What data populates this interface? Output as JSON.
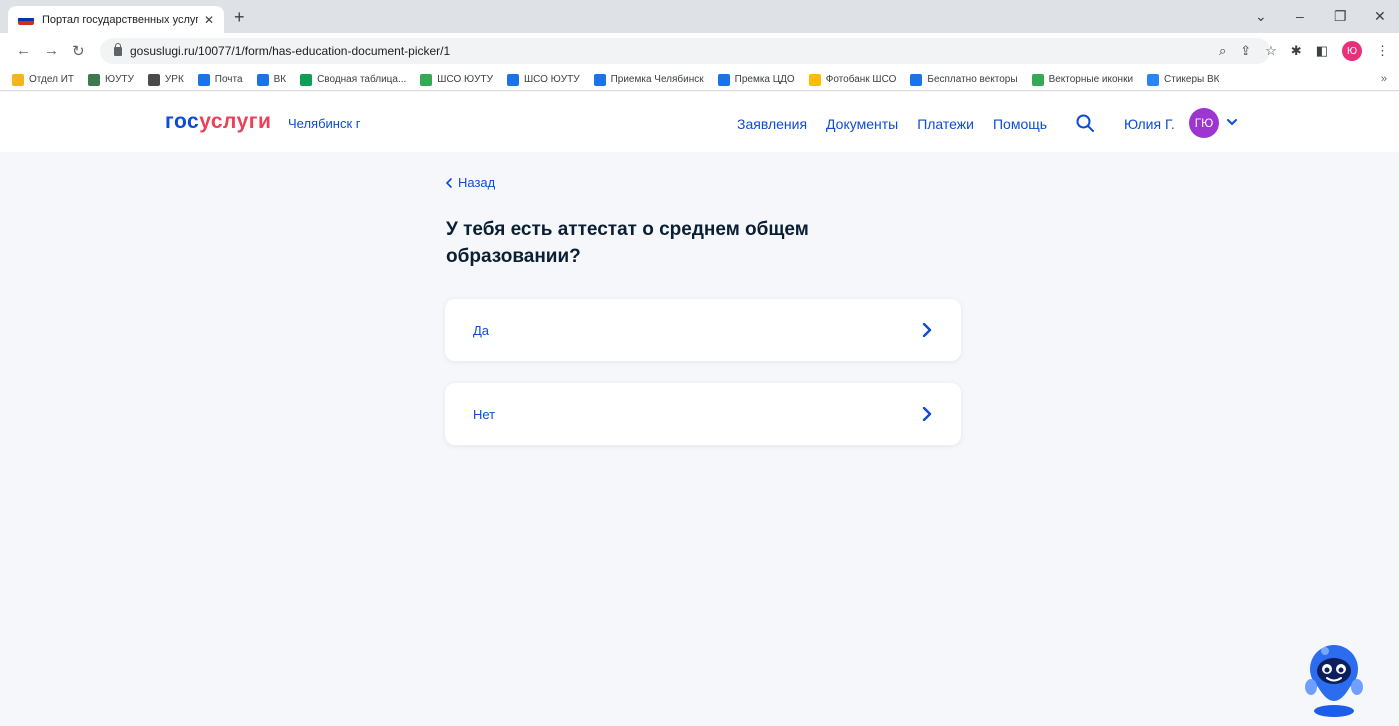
{
  "browser": {
    "tab_title": "Портал государственных услуг",
    "url": "gosuslugi.ru/10077/1/form/has-education-document-picker/1",
    "profile_initial": "Ю",
    "bookmarks": [
      {
        "label": "Отдел ИТ",
        "color": "#f2b51c"
      },
      {
        "label": "ЮУТУ",
        "color": "#3d7a4e"
      },
      {
        "label": "УРК",
        "color": "#4a4a4a"
      },
      {
        "label": "Почта",
        "color": "#1a73e8"
      },
      {
        "label": "ВК",
        "color": "#1a73e8"
      },
      {
        "label": "Сводная таблица...",
        "color": "#0f9d58"
      },
      {
        "label": "ШСО ЮУТУ",
        "color": "#34a853"
      },
      {
        "label": "ШСО ЮУТУ",
        "color": "#1a73e8"
      },
      {
        "label": "Приемка Челябинск",
        "color": "#1a73e8"
      },
      {
        "label": "Премка ЦДО",
        "color": "#1a73e8"
      },
      {
        "label": "Фотобанк ШСО",
        "color": "#fbbc04"
      },
      {
        "label": "Бесплатно векторы",
        "color": "#1a73e8"
      },
      {
        "label": "Векторные иконки",
        "color": "#34a853"
      },
      {
        "label": "Стикеры ВК",
        "color": "#2787f5"
      }
    ]
  },
  "header": {
    "logo_part1": "гос",
    "logo_part2": "услуги",
    "city": "Челябинск г",
    "nav": [
      "Заявления",
      "Документы",
      "Платежи",
      "Помощь"
    ],
    "user_name": "Юлия Г.",
    "user_initials": "ГЮ"
  },
  "content": {
    "back_label": "Назад",
    "question": "У тебя есть аттестат о среднем общем образовании?",
    "options": [
      "Да",
      "Нет"
    ]
  },
  "colors": {
    "brand_blue": "#0d4cd3",
    "brand_red": "#ee3f58",
    "avatar_bg": "#9d35d0"
  }
}
